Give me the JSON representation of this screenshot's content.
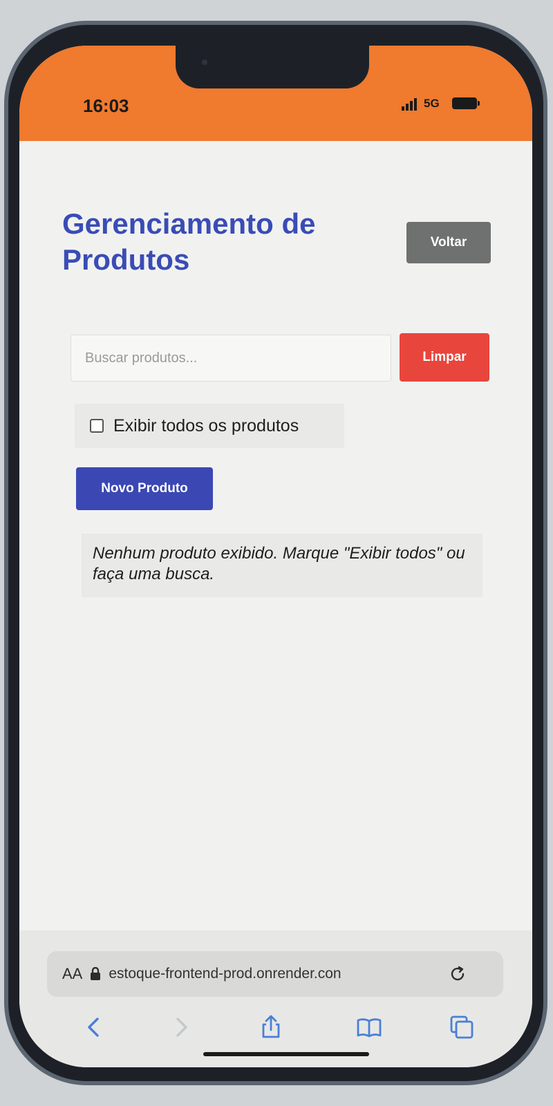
{
  "status_bar": {
    "time": "16:03",
    "network": "5G",
    "color": "#f07a2e"
  },
  "header": {
    "title": "Gerenciamento de Produtos",
    "back_label": "Voltar"
  },
  "search": {
    "placeholder": "Buscar produtos...",
    "value": "",
    "clear_label": "Limpar"
  },
  "filter": {
    "show_all_label": "Exibir todos os produtos",
    "checked": false
  },
  "actions": {
    "new_product_label": "Novo Produto"
  },
  "message": {
    "empty_text": "Nenhum produto exibido. Marque \"Exibir todos\" ou faça uma busca."
  },
  "browser": {
    "aa_label": "AA",
    "url": "estoque-frontend-prod.onrender.con",
    "icons": [
      "back-arrow-icon",
      "forward-arrow-icon",
      "share-icon",
      "bookmarks-icon",
      "tabs-icon"
    ]
  },
  "colors": {
    "title": "#3a4cb5",
    "primary": "#3b48b4",
    "danger": "#e8453c",
    "secondary": "#6f7170"
  }
}
